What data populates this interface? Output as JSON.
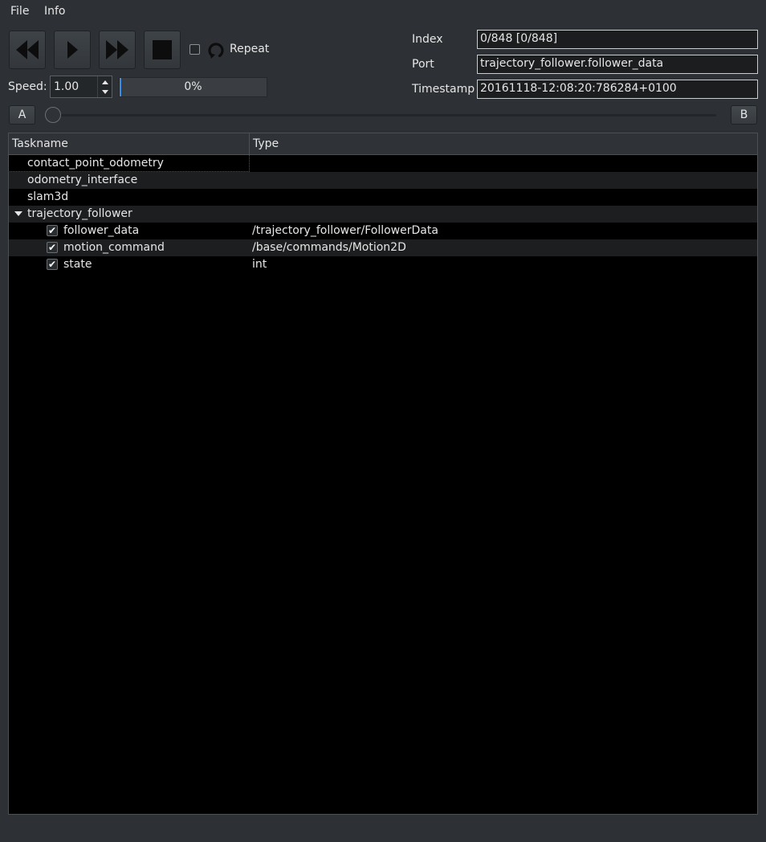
{
  "menu": {
    "file": "File",
    "info": "Info"
  },
  "toolbar": {
    "repeat_label": "Repeat",
    "speed_label": "Speed:",
    "speed_value": "1.00",
    "progress_text": "0%",
    "progress_fraction": 0.0
  },
  "info": {
    "index_label": "Index",
    "index_value": "0/848   [0/848]",
    "port_label": "Port",
    "port_value": "trajectory_follower.follower_data",
    "timestamp_label": "Timestamp",
    "timestamp_value": "20161118-12:08:20:786284+0100"
  },
  "range": {
    "a_label": "A",
    "b_label": "B"
  },
  "table": {
    "col_taskname": "Taskname",
    "col_type": "Type",
    "rows": [
      {
        "name": "contact_point_odometry",
        "type": ""
      },
      {
        "name": "odometry_interface",
        "type": ""
      },
      {
        "name": "slam3d",
        "type": ""
      },
      {
        "name": "trajectory_follower",
        "type": "",
        "expanded": true
      },
      {
        "name": "follower_data",
        "type": "/trajectory_follower/FollowerData",
        "checked": true
      },
      {
        "name": "motion_command",
        "type": "/base/commands/Motion2D",
        "checked": true
      },
      {
        "name": "state",
        "type": "int",
        "checked": true
      }
    ]
  },
  "icons": {
    "rewind": "rewind-icon",
    "play": "play-icon",
    "fast_forward": "fast-forward-icon",
    "stop": "stop-icon",
    "repeat": "repeat-icon",
    "expand": "chevron-down-icon",
    "check": "check-icon"
  },
  "colors": {
    "background": "#2d3135",
    "tree_background": "#000000",
    "accent": "#3a8ee6"
  }
}
